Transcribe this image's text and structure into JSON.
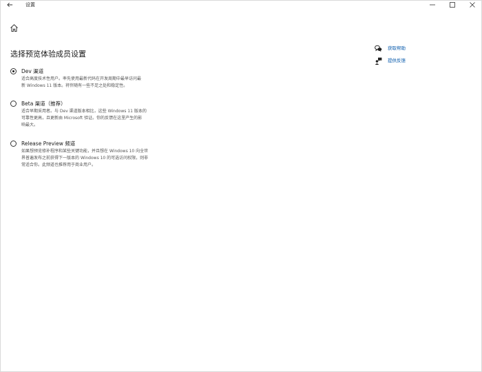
{
  "window": {
    "title": "设置"
  },
  "page": {
    "title": "选择预览体验成员设置"
  },
  "options": [
    {
      "label": "Dev 渠道",
      "desc1": "适合高度技术性用户。率先使用最新代码在开发周期中最早访问最",
      "desc2": "新 Windows 11 版本。将伴随有一些不足之处和稳定性。",
      "desc3": "",
      "checked": true
    },
    {
      "label": "Beta 渠道（推荐）",
      "desc1": "适合早期采用者。与 Dev 渠道版本相比，这些 Windows 11 版本的",
      "desc2": "可靠性更高，且更新由 Microsoft 验证。你的反馈在这里产生的影",
      "desc3": "响最大。",
      "checked": false
    },
    {
      "label": "Release Preview 频道",
      "desc1": "如果想预览修补程序和某些关键功能，并且想在 Windows 10 向全世",
      "desc2": "界普遍发布之前获得下一版本的 Windows 10 的可选访问权限，则非",
      "desc3": "常适合你。此频道也推荐用于商业用户。",
      "checked": false
    }
  ],
  "related": {
    "help_label": "获取帮助",
    "feedback_label": "提供反馈"
  },
  "colors": {
    "link": "#0b5cad",
    "text": "#1a1a1a",
    "secondary_text": "#555555"
  }
}
